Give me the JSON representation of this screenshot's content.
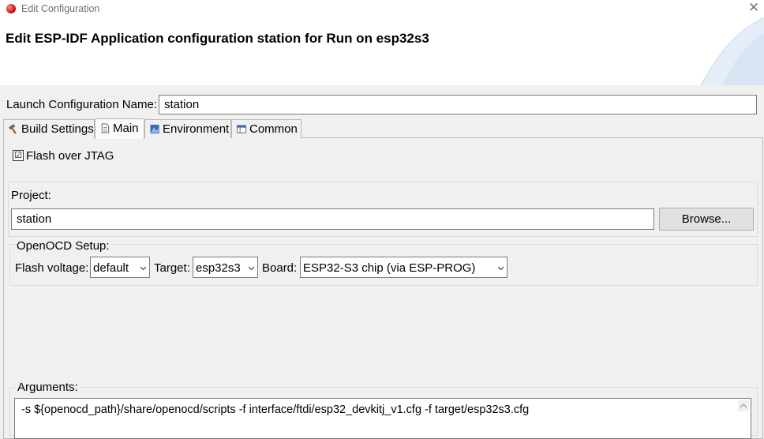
{
  "window": {
    "title": "Edit Configuration",
    "close_icon": "close-icon",
    "app_icon": "esp-icon"
  },
  "header": {
    "title": "Edit ESP-IDF Application configuration station for Run on esp32s3"
  },
  "launch_name": {
    "label": "Launch Configuration Name:",
    "value": "station"
  },
  "tabs": [
    {
      "label": "Build Settings",
      "icon": "hammer-icon"
    },
    {
      "label": "Main",
      "icon": "document-icon",
      "active": true
    },
    {
      "label": "Environment",
      "icon": "environment-icon"
    },
    {
      "label": "Common",
      "icon": "table-icon"
    }
  ],
  "main": {
    "flash_over_jtag": {
      "label": "Flash over JTAG",
      "checked": true,
      "mark": "☑"
    },
    "project": {
      "label": "Project:",
      "value": "station",
      "browse_label": "Browse..."
    },
    "openocd": {
      "label": "OpenOCD Setup:",
      "flash_voltage": {
        "label": "Flash voltage:",
        "value": "default"
      },
      "target": {
        "label": "Target:",
        "value": "esp32s3"
      },
      "board": {
        "label": "Board:",
        "value": "ESP32-S3 chip (via ESP-PROG)"
      }
    },
    "arguments": {
      "label": "Arguments:",
      "value": "-s ${openocd_path}/share/openocd/scripts -f interface/ftdi/esp32_devkitj_v1.cfg -f target/esp32s3.cfg"
    }
  },
  "colors": {
    "header_bg": "#ffffff",
    "body_bg": "#f0f0f0",
    "swoosh": "#dce8f5"
  }
}
